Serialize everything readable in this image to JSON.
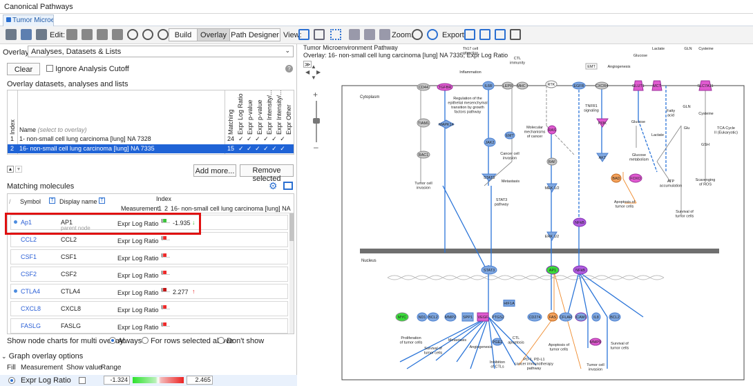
{
  "app": {
    "title": "Canonical Pathways"
  },
  "tab": {
    "label": "Tumor Microe..."
  },
  "toolbar": {
    "edit_label": "Edit:",
    "build_label": "Build",
    "overlay_label": "Overlay",
    "path_designer_label": "Path Designer",
    "view_label": "View:",
    "zoom_label": "Zoom:",
    "export_label": "Export:"
  },
  "overlay": {
    "label": "Overlay:",
    "selected": "Analyses, Datasets & Lists",
    "clear_label": "Clear",
    "ignore_cutoff_label": "Ignore Analysis Cutoff",
    "datasets_heading": "Overlay datasets, analyses and lists",
    "add_more_label": "Add more...",
    "remove_selected_label": "Remove selected"
  },
  "dataset_table": {
    "index_header": "Index",
    "name_header": "Name",
    "name_hint": "(select to overlay)",
    "col_headers": [
      "Matching",
      "Expr Log Ratio",
      "Expr p-value",
      "Expr p-value",
      "Expr Intensity/...",
      "Expr Intensity/...",
      "Expr Other"
    ],
    "rows": [
      {
        "index": "1",
        "name": "1- non-small cell lung carcinoma [lung] NA 7328",
        "matching": "24",
        "checks": "✓ ✓ ✓ ✓ ✓ ✓"
      },
      {
        "index": "2",
        "name": "16- non-small cell lung carcinoma [lung] NA 7335",
        "matching": "15",
        "checks": "✓ ✓ ✓ ✓ ✓ ✓"
      }
    ]
  },
  "molecules": {
    "heading": "Matching molecules",
    "symbol_header": "Symbol",
    "display_header": "Display name",
    "index_header": "Index",
    "measurement_header": "Measurement",
    "index_1": "1",
    "index_2": "2",
    "dataset_name": "16- non-small cell lung carcinoma [lung] NA 7335",
    "rows": [
      {
        "symbol": "Ap1",
        "display": "AP1",
        "sub": "parent node",
        "measure": "Expr Log Ratio",
        "value": "-1.935",
        "arrow": "↓",
        "dot": true
      },
      {
        "symbol": "CCL2",
        "display": "CCL2",
        "sub": "",
        "measure": "Expr Log Ratio",
        "value": "",
        "arrow": "",
        "dot": false
      },
      {
        "symbol": "CSF1",
        "display": "CSF1",
        "sub": "",
        "measure": "Expr Log Ratio",
        "value": "",
        "arrow": "",
        "dot": false
      },
      {
        "symbol": "CSF2",
        "display": "CSF2",
        "sub": "",
        "measure": "Expr Log Ratio",
        "value": "",
        "arrow": "",
        "dot": false
      },
      {
        "symbol": "CTLA4",
        "display": "CTLA4",
        "sub": "",
        "measure": "Expr Log Ratio",
        "value": "2.277",
        "arrow": "↑",
        "dot": true
      },
      {
        "symbol": "CXCL8",
        "display": "CXCL8",
        "sub": "",
        "measure": "Expr Log Ratio",
        "value": "",
        "arrow": "",
        "dot": false
      },
      {
        "symbol": "FASLG",
        "display": "FASLG",
        "sub": "",
        "measure": "Expr Log Ratio",
        "value": "",
        "arrow": "",
        "dot": false
      }
    ]
  },
  "node_charts": {
    "label": "Show node charts for multi overlay:",
    "options": [
      "Always",
      "For rows selected above",
      "Don't show"
    ]
  },
  "graph_options": {
    "heading": "Graph overlay options",
    "fill_header": "Fill",
    "measurement_header": "Measurement",
    "show_value_header": "Show value",
    "range_header": "Range",
    "row_label": "Expr Log Ratio",
    "range_min": "-1.324",
    "range_max": "2.465"
  },
  "pathway": {
    "title": "Tumor Microenvironment Pathway",
    "overlay_line": "Overlay: 16- non-small cell lung carcinoma [lung] NA 7335; Expr Log Ratio",
    "cytoplasm_label": "Cytoplasm",
    "nucleus_label": "Nucleus",
    "nodes": {
      "th17": "Th17 cell\nattraction",
      "inflammation": "Inflammation",
      "ctl_immunity": "CTL\nimmunity",
      "emt_top": "EMT",
      "angiogenesis_top": "Angiogenesis",
      "lactate_top": "Lactate",
      "glucose_top": "Glucose",
      "gln_top": "GLN",
      "cysteine_top": "Cysteine",
      "cd44": "CD44",
      "tgfbr": "TGFBR",
      "il6r": "IL6R",
      "lepr": "LEPR",
      "mhc1": "MHC I",
      "rtk": "RTK",
      "egfr": "EGFR",
      "cxcr4": "CXCR4",
      "glut1": "GLUT1",
      "mct": "MCT",
      "slc7a11": "SLC7A11",
      "regulation": "Regulation of the\nepithelial mesenchymal\ntransition by growth\nfactors pathway",
      "tiam1": "TIAM1",
      "mapk14": "MAPK14",
      "jak2": "JAK2",
      "emt_mid": "EMT",
      "molecular": "Molecular\nmechanisms\nof cancer",
      "ras": "RAS",
      "tnfr1": "TNFR1\nsignaling",
      "pi3k": "PI3K",
      "glucose_mid": "Glucose",
      "lactate_mid": "Lactate",
      "fatty_acid": "Fatty\nacid",
      "gln_mid": "GLN",
      "cysteine_mid": "Cysteine",
      "glu": "Glu",
      "tca": "TCA Cycle\nII (Eukaryotic)",
      "gsh": "GSH",
      "rac1": "RAC1",
      "cancer_cell": "Cancer cell\ninvasion",
      "raf": "RAF",
      "akt": "AKT",
      "glucose_metab": "Glucose\nmetabolism",
      "atp": "ATP\naccumulation",
      "ros": "Scavenging\nof ROS",
      "tumor_invasion": "Tumor cell\ninvasion",
      "stat3": "STAT3",
      "metastasis_mid": "Metastasis",
      "mek": "MEK\n1/2",
      "bad": "BAD",
      "foxo": "FOXO",
      "stat3_pathway": "STAT3\npathway",
      "apoptosis_mid": "Apoptosis of\ntumor cells",
      "survival_right": "Survival of\ntumor cells",
      "nfkb_mid": "NFkB",
      "erk": "ERK\n1/2",
      "stat3_nuc": "STAT3",
      "ap1": "AP1",
      "nfkb_nuc": "NFkB",
      "myc": "MYC",
      "nd1": "ND1",
      "bcl2_a": "BCL2",
      "mmp2": "MMP2",
      "spp1": "SPP1",
      "vegf": "VEGF",
      "hif1a": "HIF1A",
      "ptgs2": "PTGS2",
      "cd274": "CD274",
      "fas": "FAS",
      "cflar": "CFLAR",
      "icam1": "ICAM1",
      "il8": "IL8",
      "bcl2_b": "BCL2",
      "mmp9": "MMP9",
      "proliferation": "Proliferation\nof tumor cells",
      "survival_a": "Survival of\ntumor cells",
      "metastasis_nuc": "Metastasis",
      "angiogenesis_nuc": "Angiogenesis",
      "pge2": "PGE2",
      "ctl_apoptosis": "CTL\napoptosis",
      "inhibition": "Inhibition\nof CTLs",
      "apoptosis_nuc": "Apoptosis of\ntumor cells",
      "survival_b": "Survival of\ntumor cells",
      "pd1": "PD-1, PD-L1\ncancer immunotherapy\npathway",
      "tumor_invasion_nuc": "Tumor cell\ninvasion"
    }
  },
  "colors": {
    "accent": "#2a6fd1",
    "selected_row": "#1f63d6",
    "highlight_box": "#e01010",
    "down_green": "#3ac23a",
    "up_red": "#e82020"
  }
}
